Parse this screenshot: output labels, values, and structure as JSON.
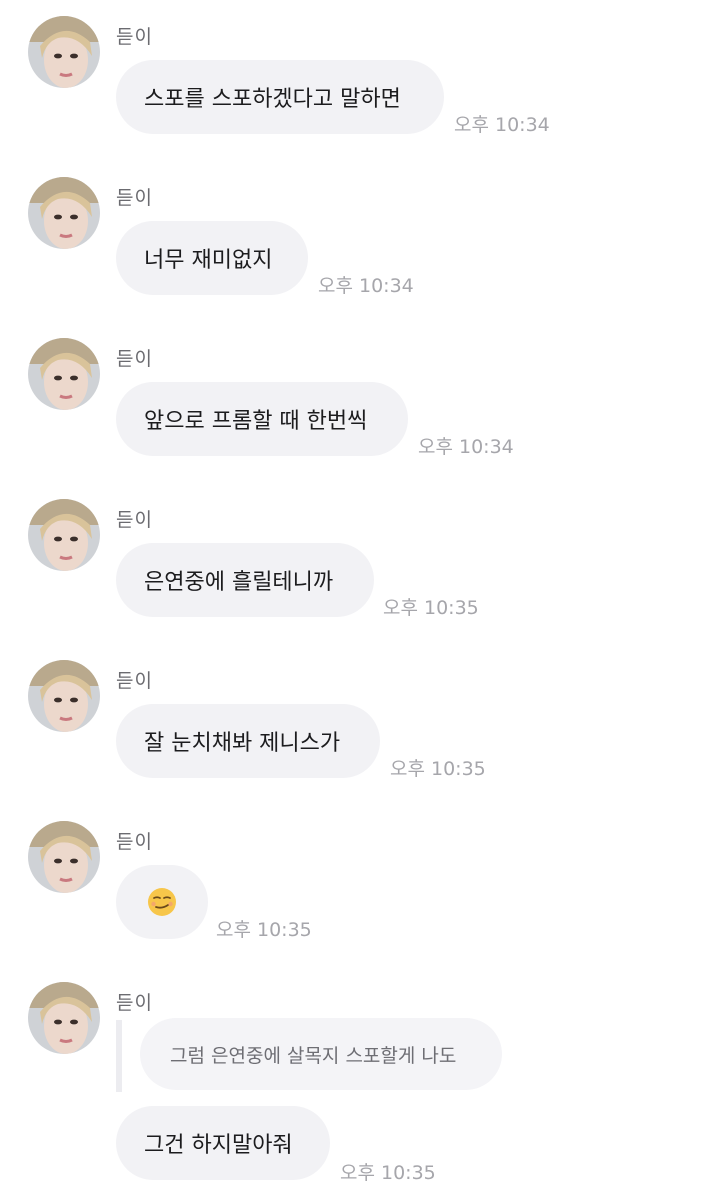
{
  "messages": [
    {
      "sender": "듣이",
      "text": "스포를 스포하겠다고 말하면",
      "time": "오후 10:34"
    },
    {
      "sender": "듣이",
      "text": "너무 재미없지",
      "time": "오후 10:34"
    },
    {
      "sender": "듣이",
      "text": "앞으로 프롬할 때 한번씩",
      "time": "오후 10:34"
    },
    {
      "sender": "듣이",
      "text": "은연중에 흘릴테니까",
      "time": "오후 10:35"
    },
    {
      "sender": "듣이",
      "text": "잘 눈치채봐 제니스가",
      "time": "오후 10:35"
    },
    {
      "sender": "듣이",
      "emoji": "smirking-face",
      "time": "오후 10:35"
    },
    {
      "sender": "듣이",
      "reply_to": "그럼 은연중에 살목지 스포할게 나도",
      "text": "그건 하지말아줘",
      "time": "오후 10:35"
    }
  ],
  "colors": {
    "bubble": "#f2f2f5",
    "text": "#1c1c1e",
    "time": "#a6a6ab",
    "sender": "#6b6b70"
  }
}
